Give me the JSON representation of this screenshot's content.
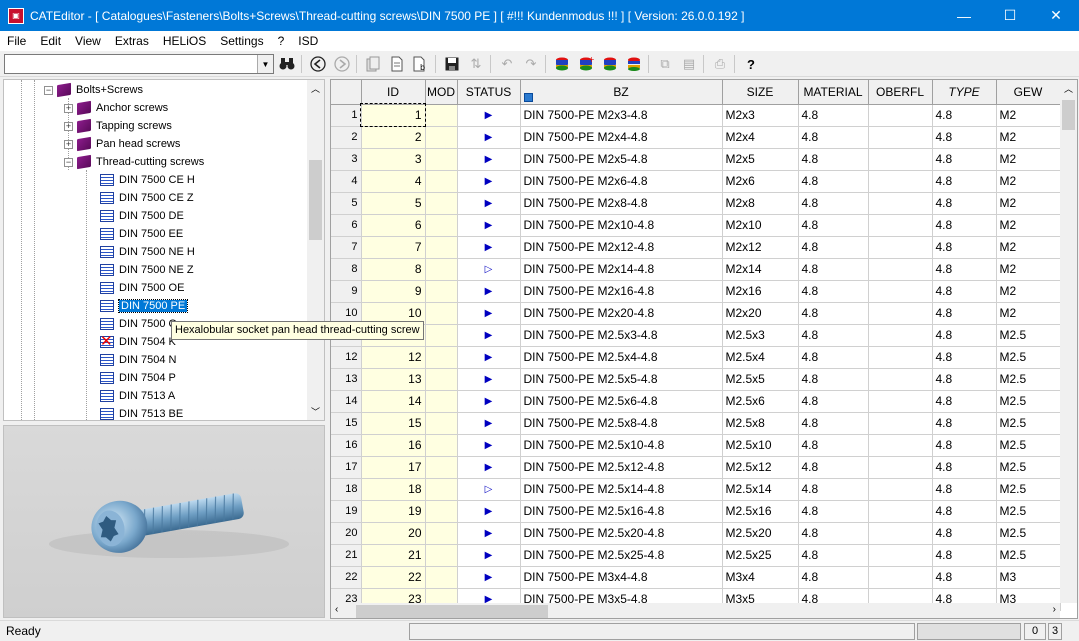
{
  "window": {
    "title": "CATEditor - [ Catalogues\\Fasteners\\Bolts+Screws\\Thread-cutting screws\\DIN 7500 PE ]    [ #!!! Kundenmodus !!! ]    [ Version: 26.0.0.192 ]",
    "minimize": "—",
    "maximize": "☐",
    "close": "✕"
  },
  "menu": [
    "File",
    "Edit",
    "View",
    "Extras",
    "HELiOS",
    "Settings",
    "?",
    "ISD"
  ],
  "search": {
    "value": ""
  },
  "tree": {
    "root": "Bolts+Screws",
    "groups": [
      {
        "label": "Anchor screws",
        "expanded": false
      },
      {
        "label": "Tapping screws",
        "expanded": false
      },
      {
        "label": "Pan head screws",
        "expanded": false
      },
      {
        "label": "Thread-cutting screws",
        "expanded": true
      }
    ],
    "tables": [
      "DIN 7500 CE H",
      "DIN 7500 CE Z",
      "DIN 7500 DE",
      "DIN 7500 EE",
      "DIN 7500 NE H",
      "DIN 7500 NE Z",
      "DIN 7500 OE",
      "DIN 7500 PE",
      "DIN 7500 Q",
      "DIN 7504 K",
      "DIN 7504 N",
      "DIN 7504 P",
      "DIN 7513 A",
      "DIN 7513 BE"
    ],
    "selected": "DIN 7500 PE",
    "tooltip": "Hexalobular socket pan head thread-cutting screw"
  },
  "grid": {
    "columns": [
      "ID",
      "MOD",
      "STATUS",
      "BZ",
      "SIZE",
      "MATERIAL",
      "OBERFL",
      "TYPE",
      "GEW"
    ],
    "rows": [
      {
        "n": "1",
        "id": "1",
        "status": "▶",
        "bz": "DIN 7500-PE M2x3-4.8",
        "size": "M2x3",
        "mat": "4.8",
        "ob": "",
        "type": "4.8",
        "gew": "M2"
      },
      {
        "n": "2",
        "id": "2",
        "status": "▶",
        "bz": "DIN 7500-PE M2x4-4.8",
        "size": "M2x4",
        "mat": "4.8",
        "ob": "",
        "type": "4.8",
        "gew": "M2"
      },
      {
        "n": "3",
        "id": "3",
        "status": "▶",
        "bz": "DIN 7500-PE M2x5-4.8",
        "size": "M2x5",
        "mat": "4.8",
        "ob": "",
        "type": "4.8",
        "gew": "M2"
      },
      {
        "n": "4",
        "id": "4",
        "status": "▶",
        "bz": "DIN 7500-PE M2x6-4.8",
        "size": "M2x6",
        "mat": "4.8",
        "ob": "",
        "type": "4.8",
        "gew": "M2"
      },
      {
        "n": "5",
        "id": "5",
        "status": "▶",
        "bz": "DIN 7500-PE M2x8-4.8",
        "size": "M2x8",
        "mat": "4.8",
        "ob": "",
        "type": "4.8",
        "gew": "M2"
      },
      {
        "n": "6",
        "id": "6",
        "status": "▶",
        "bz": "DIN 7500-PE M2x10-4.8",
        "size": "M2x10",
        "mat": "4.8",
        "ob": "",
        "type": "4.8",
        "gew": "M2"
      },
      {
        "n": "7",
        "id": "7",
        "status": "▶",
        "bz": "DIN 7500-PE M2x12-4.8",
        "size": "M2x12",
        "mat": "4.8",
        "ob": "",
        "type": "4.8",
        "gew": "M2"
      },
      {
        "n": "8",
        "id": "8",
        "status": "▷",
        "bz": "DIN 7500-PE M2x14-4.8",
        "size": "M2x14",
        "mat": "4.8",
        "ob": "",
        "type": "4.8",
        "gew": "M2"
      },
      {
        "n": "9",
        "id": "9",
        "status": "▶",
        "bz": "DIN 7500-PE M2x16-4.8",
        "size": "M2x16",
        "mat": "4.8",
        "ob": "",
        "type": "4.8",
        "gew": "M2"
      },
      {
        "n": "10",
        "id": "10",
        "status": "▶",
        "bz": "DIN 7500-PE M2x20-4.8",
        "size": "M2x20",
        "mat": "4.8",
        "ob": "",
        "type": "4.8",
        "gew": "M2"
      },
      {
        "n": "11",
        "id": "11",
        "status": "▶",
        "bz": "DIN 7500-PE M2.5x3-4.8",
        "size": "M2.5x3",
        "mat": "4.8",
        "ob": "",
        "type": "4.8",
        "gew": "M2.5"
      },
      {
        "n": "12",
        "id": "12",
        "status": "▶",
        "bz": "DIN 7500-PE M2.5x4-4.8",
        "size": "M2.5x4",
        "mat": "4.8",
        "ob": "",
        "type": "4.8",
        "gew": "M2.5"
      },
      {
        "n": "13",
        "id": "13",
        "status": "▶",
        "bz": "DIN 7500-PE M2.5x5-4.8",
        "size": "M2.5x5",
        "mat": "4.8",
        "ob": "",
        "type": "4.8",
        "gew": "M2.5"
      },
      {
        "n": "14",
        "id": "14",
        "status": "▶",
        "bz": "DIN 7500-PE M2.5x6-4.8",
        "size": "M2.5x6",
        "mat": "4.8",
        "ob": "",
        "type": "4.8",
        "gew": "M2.5"
      },
      {
        "n": "15",
        "id": "15",
        "status": "▶",
        "bz": "DIN 7500-PE M2.5x8-4.8",
        "size": "M2.5x8",
        "mat": "4.8",
        "ob": "",
        "type": "4.8",
        "gew": "M2.5"
      },
      {
        "n": "16",
        "id": "16",
        "status": "▶",
        "bz": "DIN 7500-PE M2.5x10-4.8",
        "size": "M2.5x10",
        "mat": "4.8",
        "ob": "",
        "type": "4.8",
        "gew": "M2.5"
      },
      {
        "n": "17",
        "id": "17",
        "status": "▶",
        "bz": "DIN 7500-PE M2.5x12-4.8",
        "size": "M2.5x12",
        "mat": "4.8",
        "ob": "",
        "type": "4.8",
        "gew": "M2.5"
      },
      {
        "n": "18",
        "id": "18",
        "status": "▷",
        "bz": "DIN 7500-PE M2.5x14-4.8",
        "size": "M2.5x14",
        "mat": "4.8",
        "ob": "",
        "type": "4.8",
        "gew": "M2.5"
      },
      {
        "n": "19",
        "id": "19",
        "status": "▶",
        "bz": "DIN 7500-PE M2.5x16-4.8",
        "size": "M2.5x16",
        "mat": "4.8",
        "ob": "",
        "type": "4.8",
        "gew": "M2.5"
      },
      {
        "n": "20",
        "id": "20",
        "status": "▶",
        "bz": "DIN 7500-PE M2.5x20-4.8",
        "size": "M2.5x20",
        "mat": "4.8",
        "ob": "",
        "type": "4.8",
        "gew": "M2.5"
      },
      {
        "n": "21",
        "id": "21",
        "status": "▶",
        "bz": "DIN 7500-PE M2.5x25-4.8",
        "size": "M2.5x25",
        "mat": "4.8",
        "ob": "",
        "type": "4.8",
        "gew": "M2.5"
      },
      {
        "n": "22",
        "id": "22",
        "status": "▶",
        "bz": "DIN 7500-PE M3x4-4.8",
        "size": "M3x4",
        "mat": "4.8",
        "ob": "",
        "type": "4.8",
        "gew": "M3"
      },
      {
        "n": "23",
        "id": "23",
        "status": "▶",
        "bz": "DIN 7500-PE M3x5-4.8",
        "size": "M3x5",
        "mat": "4.8",
        "ob": "",
        "type": "4.8",
        "gew": "M3"
      }
    ]
  },
  "status": {
    "text": "Ready",
    "pane1": "0",
    "pane2": "3"
  },
  "colors": {
    "titlebar": "#0078d7",
    "id_column": "#ffffe1",
    "status_arrow": "#0000c0"
  }
}
